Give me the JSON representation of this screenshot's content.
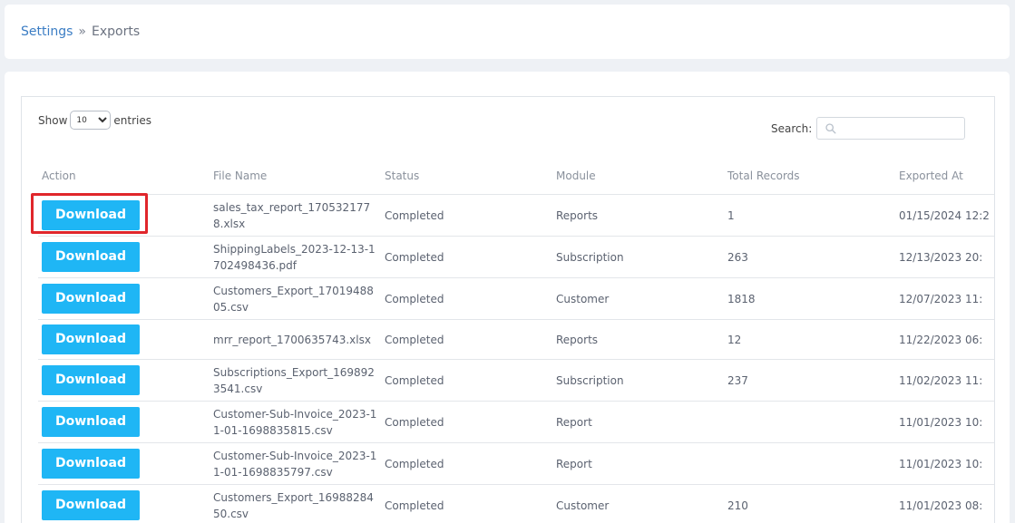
{
  "breadcrumb": {
    "parent": "Settings",
    "separator": "»",
    "current": "Exports"
  },
  "table_controls": {
    "show_label": "Show",
    "entries_label": "entries",
    "page_length": "10",
    "search_label": "Search:",
    "search_value": ""
  },
  "columns": [
    "Action",
    "File Name",
    "Status",
    "Module",
    "Total Records",
    "Exported At"
  ],
  "rows": [
    {
      "action": "Download",
      "file_name": "sales_tax_report_1705321778.xlsx",
      "status": "Completed",
      "module": "Reports",
      "total_records": "1",
      "exported_at": "01/15/2024 12:2"
    },
    {
      "action": "Download",
      "file_name": "ShippingLabels_2023-12-13-1702498436.pdf",
      "status": "Completed",
      "module": "Subscription",
      "total_records": "263",
      "exported_at": "12/13/2023 20:"
    },
    {
      "action": "Download",
      "file_name": "Customers_Export_1701948805.csv",
      "status": "Completed",
      "module": "Customer",
      "total_records": "1818",
      "exported_at": "12/07/2023 11:"
    },
    {
      "action": "Download",
      "file_name": "mrr_report_1700635743.xlsx",
      "status": "Completed",
      "module": "Reports",
      "total_records": "12",
      "exported_at": "11/22/2023 06:"
    },
    {
      "action": "Download",
      "file_name": "Subscriptions_Export_1698923541.csv",
      "status": "Completed",
      "module": "Subscription",
      "total_records": "237",
      "exported_at": "11/02/2023 11:"
    },
    {
      "action": "Download",
      "file_name": "Customer-Sub-Invoice_2023-11-01-1698835815.csv",
      "status": "Completed",
      "module": "Report",
      "total_records": "",
      "exported_at": "11/01/2023 10:"
    },
    {
      "action": "Download",
      "file_name": "Customer-Sub-Invoice_2023-11-01-1698835797.csv",
      "status": "Completed",
      "module": "Report",
      "total_records": "",
      "exported_at": "11/01/2023 10:"
    },
    {
      "action": "Download",
      "file_name": "Customers_Export_1698828450.csv",
      "status": "Completed",
      "module": "Customer",
      "total_records": "210",
      "exported_at": "11/01/2023 08:"
    }
  ],
  "colors": {
    "button": "#1fb6f5",
    "highlight": "#e0262b",
    "link": "#3b7dc4"
  },
  "icons": {
    "search": "search-icon",
    "select": "chevron-down-icon"
  }
}
